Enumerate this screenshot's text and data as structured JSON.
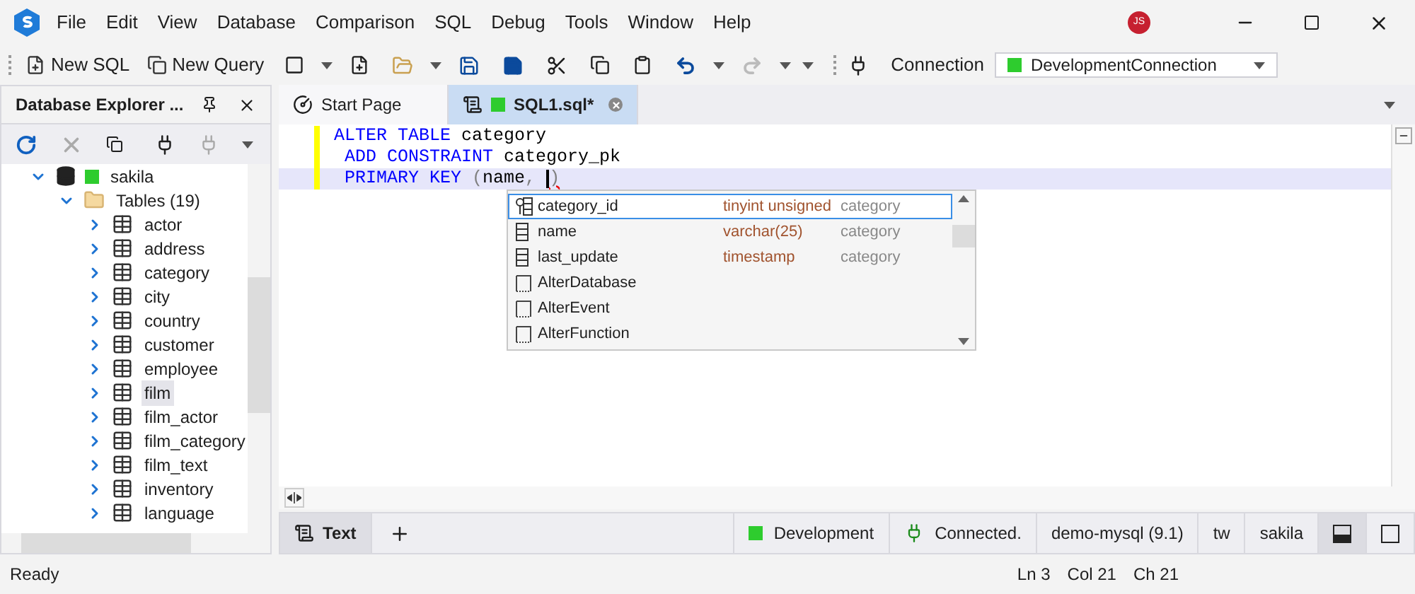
{
  "menu": [
    "File",
    "Edit",
    "View",
    "Database",
    "Comparison",
    "SQL",
    "Debug",
    "Tools",
    "Window",
    "Help"
  ],
  "user": {
    "initials": "JS"
  },
  "toolbar": {
    "buttons": [
      {
        "label": "New SQL",
        "kind": "new-sql"
      },
      {
        "label": "New Query",
        "kind": "new-query"
      }
    ],
    "connection_label": "Connection",
    "connection": {
      "value": "DevelopmentConnection",
      "color": "#2ecc2e"
    }
  },
  "explorer": {
    "title": "Database Explorer ...",
    "tree": [
      {
        "label": "sakila",
        "kind": "database",
        "color": "#2ecc2e",
        "expanded": true,
        "children": [
          {
            "label": "Tables (19)",
            "kind": "folder",
            "expanded": true,
            "children": [
              {
                "label": "actor",
                "kind": "table",
                "expanded": false,
                "selected": false
              },
              {
                "label": "address",
                "kind": "table",
                "expanded": false,
                "selected": false
              },
              {
                "label": "category",
                "kind": "table",
                "expanded": false,
                "selected": false
              },
              {
                "label": "city",
                "kind": "table",
                "expanded": false,
                "selected": false
              },
              {
                "label": "country",
                "kind": "table",
                "expanded": false,
                "selected": false
              },
              {
                "label": "customer",
                "kind": "table",
                "expanded": false,
                "selected": false
              },
              {
                "label": "employee",
                "kind": "table",
                "expanded": false,
                "selected": false
              },
              {
                "label": "film",
                "kind": "table",
                "expanded": false,
                "selected": true
              },
              {
                "label": "film_actor",
                "kind": "table",
                "expanded": false,
                "selected": false
              },
              {
                "label": "film_category",
                "kind": "table",
                "expanded": false,
                "selected": false
              },
              {
                "label": "film_text",
                "kind": "table",
                "expanded": false,
                "selected": false
              },
              {
                "label": "inventory",
                "kind": "table",
                "expanded": false,
                "selected": false
              },
              {
                "label": "language",
                "kind": "table",
                "expanded": false,
                "selected": false
              }
            ]
          }
        ]
      }
    ]
  },
  "tabs": [
    {
      "label": "Start Page",
      "kind": "start",
      "selected": false
    },
    {
      "label": "SQL1.sql*",
      "kind": "sql",
      "color": "#2ecc2e",
      "selected": true
    }
  ],
  "editor": {
    "lines": [
      {
        "current": false,
        "tokens": [
          {
            "kind": "keyword",
            "text": "ALTER TABLE"
          },
          {
            "kind": "ident",
            "text": " category"
          }
        ]
      },
      {
        "current": false,
        "tokens": [
          {
            "kind": "keyword",
            "text": " ADD CONSTRAINT"
          },
          {
            "kind": "ident",
            "text": " category_pk"
          }
        ]
      },
      {
        "current": true,
        "tokens": [
          {
            "kind": "keyword",
            "text": " PRIMARY KEY"
          },
          {
            "kind": "punct",
            "text": " ("
          },
          {
            "kind": "ident",
            "text": "name"
          },
          {
            "kind": "punct",
            "text": ", "
          },
          {
            "kind": "caret"
          },
          {
            "kind": "error",
            "text": ")"
          }
        ]
      }
    ]
  },
  "completion": [
    {
      "kind": "key-column",
      "name": "category_id",
      "type": "tinyint unsigned",
      "source": "category",
      "selected": true
    },
    {
      "kind": "column",
      "name": "name",
      "type": "varchar(25)",
      "source": "category",
      "selected": false
    },
    {
      "kind": "column",
      "name": "last_update",
      "type": "timestamp",
      "source": "category",
      "selected": false
    },
    {
      "kind": "snippet",
      "name": "AlterDatabase",
      "selected": false
    },
    {
      "kind": "snippet",
      "name": "AlterEvent",
      "selected": false
    },
    {
      "kind": "snippet",
      "name": "AlterFunction",
      "selected": false
    }
  ],
  "editor_bar": {
    "view_tab": {
      "label": "Text",
      "selected": true
    },
    "items": [
      {
        "kind": "env",
        "text": "Development",
        "color": "#2ecc2e"
      },
      {
        "kind": "conn",
        "text": "Connected."
      },
      {
        "kind": "plain",
        "text": "demo-mysql (9.1)"
      },
      {
        "kind": "plain",
        "text": "tw"
      },
      {
        "kind": "plain",
        "text": "sakila"
      }
    ],
    "layouts": [
      {
        "kind": "split",
        "selected": true
      },
      {
        "kind": "single",
        "selected": false
      }
    ]
  },
  "status_bar": {
    "message": "Ready",
    "position": [
      "Ln 3",
      "Col 21",
      "Ch 21"
    ]
  }
}
